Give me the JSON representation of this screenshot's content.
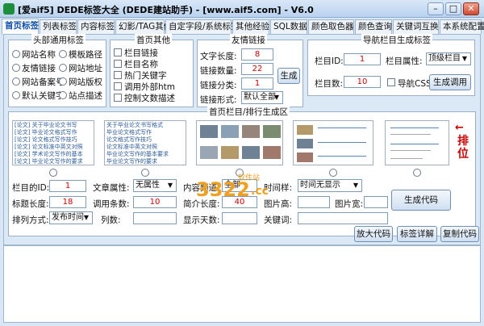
{
  "window": {
    "title": "[爱aif5] DEDE标签大全 (DEDE建站助手) - [www.aif5.com] - V6.0",
    "min": "–",
    "max": "□",
    "close": "✕"
  },
  "tabs": [
    "首页标签",
    "列表标签",
    "内容标签",
    "幻影/TAG其他",
    "自定字段/系统标签",
    "其他经验",
    "SQL数据",
    "颜色取色器",
    "颜色查询",
    "关键词互换",
    "本系统配置"
  ],
  "head_group": {
    "title": "头部通用标签",
    "items": [
      "网站名称",
      "模板路径",
      "友情链接",
      "网站地址",
      "网站备案号",
      "网站版权",
      "默认关键字",
      "站点描述"
    ]
  },
  "home_group": {
    "title": "首页其他",
    "items": [
      "栏目链接",
      "栏目名称",
      "热门关键字",
      "调用外部htm",
      "控制文数描述"
    ]
  },
  "link_group": {
    "title": "友情链接",
    "text_len_label": "文字长度:",
    "text_len": "8",
    "link_count_label": "链接数量:",
    "link_count": "22",
    "link_cat_label": "链接分类:",
    "link_cat": "1",
    "link_form_label": "链接形式:",
    "link_form": "默认全部",
    "generate": "生成"
  },
  "nav_group": {
    "title": "导航栏目生成标签",
    "col_id_label": "栏目ID:",
    "col_id": "1",
    "col_attr_label": "栏目属性:",
    "col_attr": "顶级栏目",
    "col_count_label": "栏目数:",
    "col_count": "10",
    "nav_css": "导航CSS",
    "generate": "生成调用"
  },
  "list_group": {
    "title": "首页栏目/排行生成区",
    "side_label": "排位",
    "thumb1_lines": [
      "[论文] 关于毕业论文书写",
      "[论文] 毕业论文格式写作",
      "[论文] 论文格式写作技巧",
      "[论文] 论文标准中英文对照",
      "[论文] 学术论文写作的基本",
      "[论文] 毕业论文写作的要求"
    ],
    "thumb2_lines": [
      "关于毕业论文书写格式",
      "毕业论文格式写作",
      "论文格式写作技巧",
      "论文标准中英文对照",
      "毕业论文写作的基本要求",
      "毕业论文写作的要求"
    ],
    "col_id_label": "栏目的ID:",
    "col_id": "1",
    "art_attr_label": "文章属性:",
    "art_attr": "无属性",
    "channel_label": "内容频道:",
    "channel": "全部",
    "time_label": "时间样:",
    "time": "时间无显示",
    "title_len_label": "标题长度:",
    "title_len": "18",
    "call_count_label": "调用条数:",
    "call_count": "10",
    "intro_len_label": "简介长度:",
    "intro_len": "40",
    "img_h_label": "图片高:",
    "img_h": "",
    "img_w_label": "图片宽:",
    "img_w": "",
    "sort_label": "排列方式:",
    "sort": "发布时间",
    "cols_label": "列数:",
    "cols": "",
    "days_label": "显示天数:",
    "days": "",
    "keyword_label": "关键词:",
    "keyword": "",
    "generate": "生成代码"
  },
  "actions": {
    "zoom": "放大代码",
    "detail": "标签详解",
    "copy": "复制代码"
  },
  "watermark": {
    "number": "3322",
    "suffix": ".cc",
    "tag": "软件站"
  },
  "colors": {
    "accent": "#0b4fa8",
    "input_text": "#cc0000",
    "arrow": "#cc0000"
  }
}
